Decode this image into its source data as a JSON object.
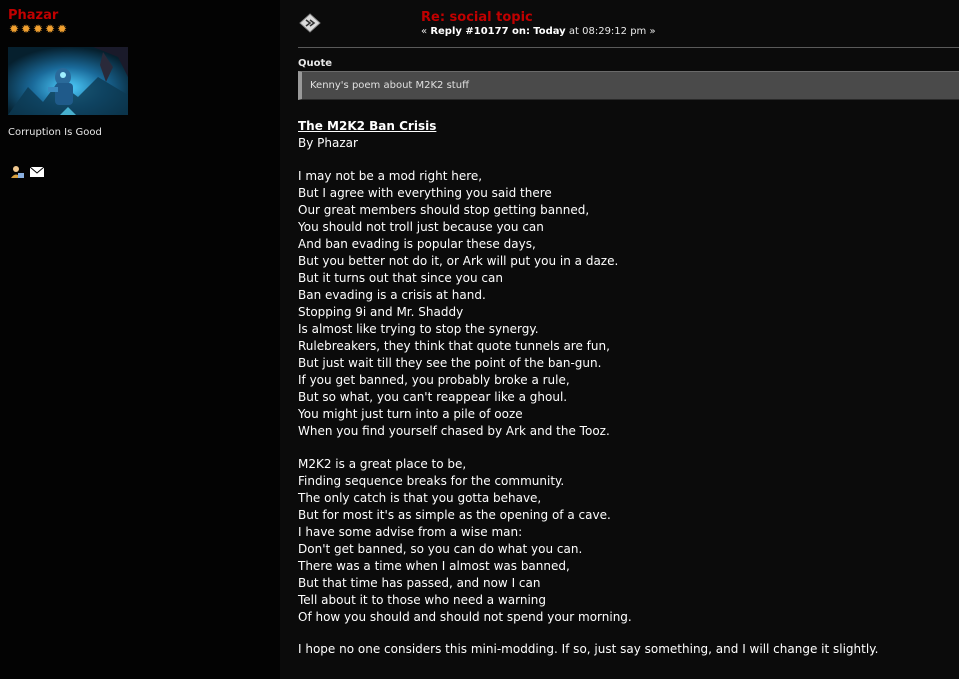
{
  "poster": {
    "username": "Phazar",
    "star_count": 5,
    "star_color": "#f0a030",
    "username_color": "#c00000",
    "personal_text": "Corruption Is Good",
    "icons": [
      "profile-icon",
      "email-icon"
    ]
  },
  "post": {
    "title": "Re: social topic",
    "meta_prefix": "«",
    "meta_reply": "Reply #10177 on:",
    "meta_day": "Today",
    "meta_time": "at 08:29:12 pm",
    "meta_suffix": "»",
    "quote_label": "Quote",
    "quote_text": "Kenny's poem about M2K2 stuff",
    "poem_title": "The M2K2 Ban Crisis",
    "poem_author": "By Phazar",
    "stanza1": [
      "I may not be a mod right here,",
      "But I agree with everything you said there",
      "Our great members should stop getting banned,",
      "You should not troll just because you can",
      "And ban evading is popular these days,",
      "But you better not do it, or Ark will put you in a daze.",
      "But it turns out that since you can",
      "Ban evading is a crisis at hand.",
      "Stopping 9i and Mr. Shaddy",
      "Is almost like trying to stop the synergy.",
      "Rulebreakers, they think that quote tunnels are fun,",
      "But just wait till they see the point of the ban-gun.",
      "If you get banned, you probably broke a rule,",
      "But so what, you can't reappear like a ghoul.",
      "You might just turn into a pile of ooze",
      "When you find yourself chased by Ark and the Tooz."
    ],
    "stanza2": [
      "M2K2 is a great place to be,",
      "Finding sequence breaks for the community.",
      "The only catch is that you gotta behave,",
      "But for most it's as simple as the opening of a cave.",
      "I have some advise from a wise man:",
      "Don't get banned, so you can do what you can.",
      "There was a time when I almost was banned,",
      "But that time has passed, and now I can",
      "Tell about it to those who need a warning",
      "Of how you should and should not spend your morning."
    ],
    "closing": "I hope no one considers this mini-modding.  If so, just say something, and I will change it slightly."
  }
}
